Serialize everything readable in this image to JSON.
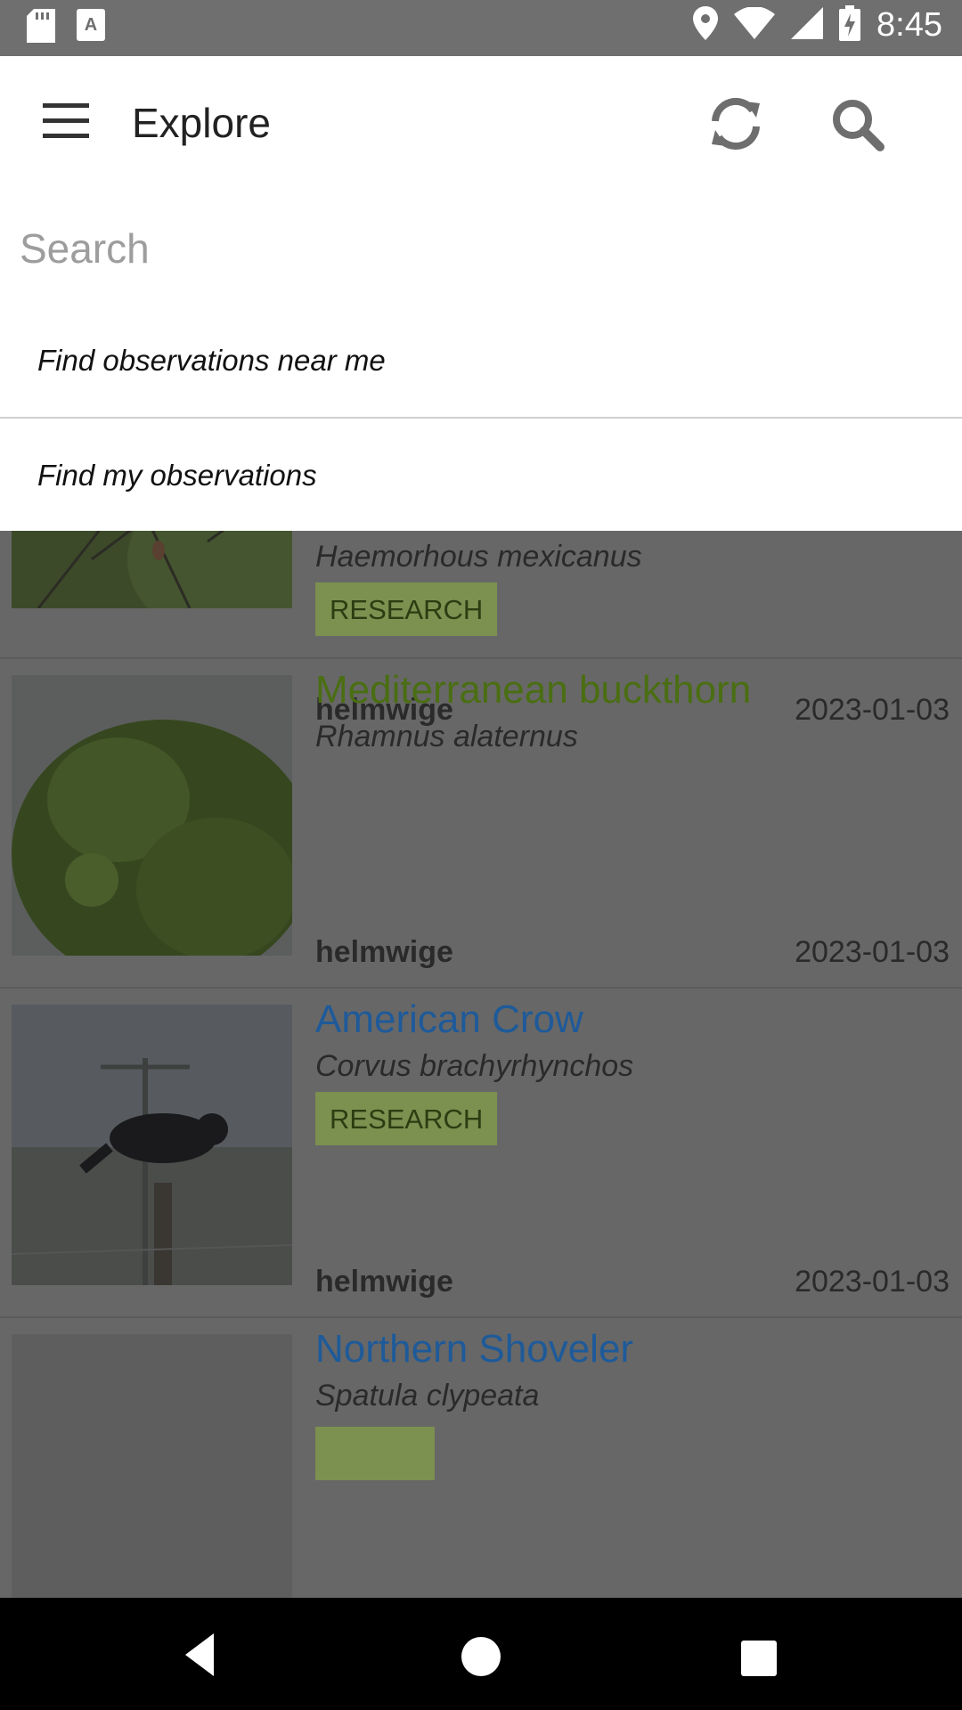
{
  "status_bar": {
    "time": "8:45",
    "icons": [
      "sd-card-icon",
      "font-icon",
      "location-icon",
      "wifi-icon",
      "signal-icon",
      "battery-icon"
    ]
  },
  "app_bar": {
    "title": "Explore",
    "icons": [
      "menu-icon",
      "sync-icon",
      "search-icon"
    ]
  },
  "search": {
    "placeholder": "Search",
    "value": ""
  },
  "suggestions": [
    "Find observations near me",
    "Find my observations"
  ],
  "observations": [
    {
      "common": "",
      "scientific": "Haemorhous mexicanus",
      "badge": "RESEARCH",
      "user": "helmwige",
      "date": "2023-01-03",
      "name_color": "#2a6fb0"
    },
    {
      "common": "Mediterranean buckthorn",
      "scientific": "Rhamnus alaternus",
      "badge": "",
      "user": "helmwige",
      "date": "2023-01-03",
      "name_color": "#4a6e12"
    },
    {
      "common": "American Crow",
      "scientific": "Corvus brachyrhynchos",
      "badge": "RESEARCH",
      "user": "helmwige",
      "date": "2023-01-03",
      "name_color": "#1e5a99"
    },
    {
      "common": "Northern Shoveler",
      "scientific": "Spatula clypeata",
      "badge": "",
      "user": "",
      "date": "",
      "name_color": "#1e5a99"
    }
  ],
  "colors": {
    "overlay": "#676767",
    "research_badge_bg": "#7c9050",
    "research_badge_text": "#2c3d12"
  }
}
